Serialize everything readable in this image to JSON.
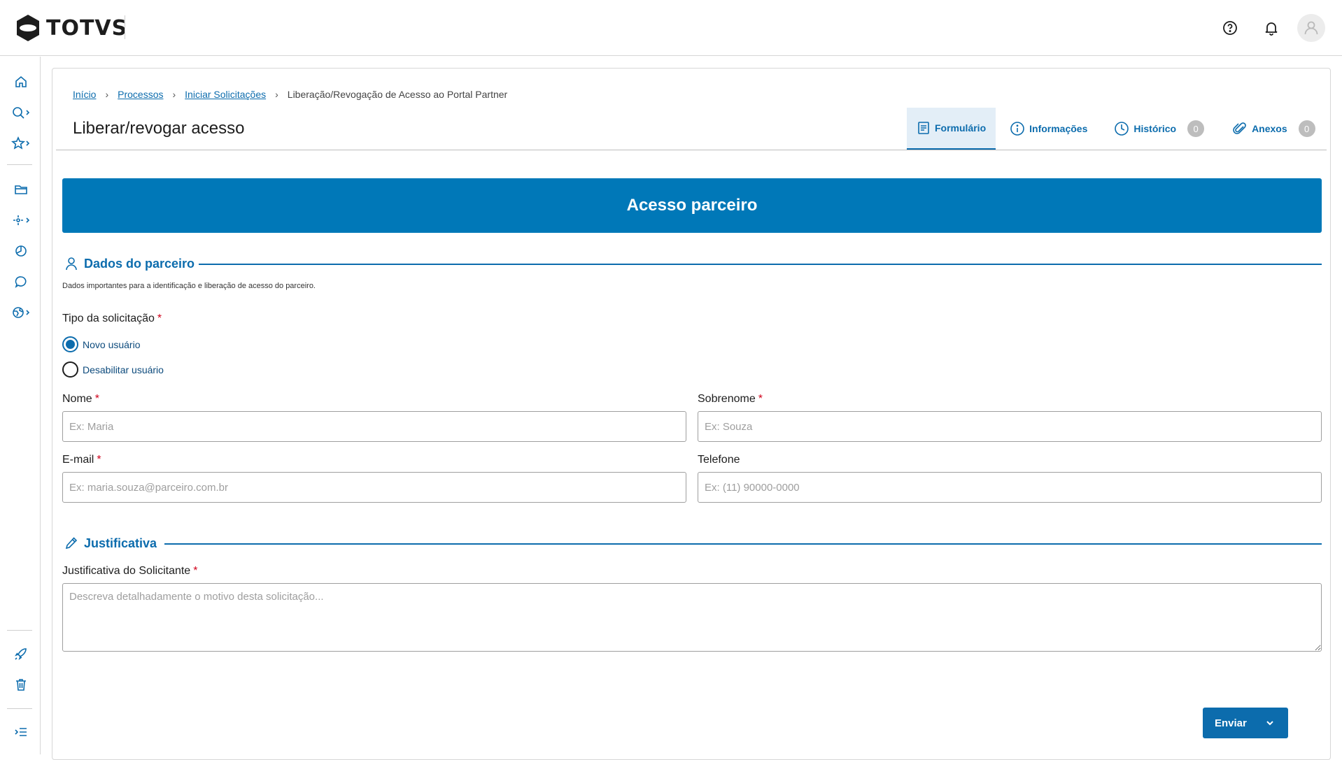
{
  "header": {
    "logo_text": "TOTVS"
  },
  "breadcrumb": {
    "items": [
      "Início",
      "Processos",
      "Iniciar Solicitações"
    ],
    "current": "Liberação/Revogação de Acesso ao Portal Partner"
  },
  "page": {
    "title": "Liberar/revogar acesso"
  },
  "tabs": [
    {
      "label": "Formulário",
      "active": true
    },
    {
      "label": "Informações"
    },
    {
      "label": "Histórico",
      "count": "0"
    },
    {
      "label": "Anexos",
      "count": "0"
    }
  ],
  "banner": {
    "title": "Acesso parceiro"
  },
  "sections": {
    "partner": {
      "title": "Dados do parceiro",
      "helper": "Dados importantes para a identificação e liberação de acesso do parceiro."
    },
    "justification": {
      "title": "Justificativa"
    }
  },
  "form": {
    "request_type": {
      "label": "Tipo da solicitação",
      "required": "*",
      "options": [
        {
          "label": "Novo usuário",
          "selected": true
        },
        {
          "label": "Desabilitar usuário",
          "selected": false
        }
      ]
    },
    "first_name": {
      "label": "Nome",
      "required": "*",
      "value": "",
      "placeholder": "Ex: Maria"
    },
    "last_name": {
      "label": "Sobrenome",
      "required": "*",
      "value": "",
      "placeholder": "Ex: Souza"
    },
    "email": {
      "label": "E-mail",
      "required": "*",
      "value": "",
      "placeholder": "Ex: maria.souza@parceiro.com.br"
    },
    "phone": {
      "label": "Telefone",
      "value": "",
      "placeholder": "Ex: (11) 90000-0000"
    },
    "justification": {
      "label": "Justificativa do Solicitante",
      "required": "*",
      "value": "",
      "placeholder": "Descreva detalhadamente o motivo desta solicitação..."
    }
  },
  "actions": {
    "submit_label": "Enviar"
  },
  "colors": {
    "primary": "#0c6cad",
    "banner": "#0078b8",
    "required": "#d0021b"
  }
}
